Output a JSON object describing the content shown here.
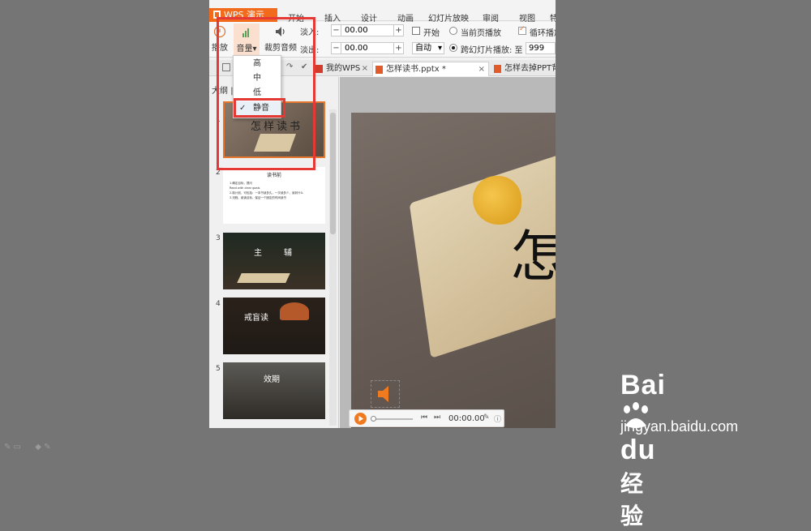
{
  "app": {
    "title": "WPS 演示"
  },
  "menu": [
    "开始",
    "插入",
    "设计",
    "动画",
    "幻灯片放映",
    "审阅",
    "视图",
    "特"
  ],
  "ribbon": {
    "play_label": "播放",
    "volume_label": "音量",
    "volume_caret": "▾",
    "trim_label": "裁剪音频",
    "fade_in_label": "淡入:",
    "fade_in_value": "00.00",
    "fade_out_label": "淡出:",
    "fade_out_value": "00.00",
    "minus": "−",
    "plus": "+",
    "start_label": "开始",
    "start_value": "自动",
    "current_page_label": "当前页播放",
    "cross_slide_label": "跨幻灯片播放: 至",
    "cross_slide_value": "999",
    "loop_label": "循环播放"
  },
  "volume_menu": {
    "items": [
      "高",
      "中",
      "低",
      "静音"
    ],
    "selected_mark": "✓"
  },
  "tabs": [
    {
      "label": "我的WPS",
      "close": "×"
    },
    {
      "label": "怎样读书.pptx *",
      "close": "×"
    },
    {
      "label": "怎样去掉PPT背景"
    }
  ],
  "side": {
    "label": "大纲",
    "sep": "|"
  },
  "thumbnails": [
    {
      "num": "1",
      "title": "怎样读书"
    },
    {
      "num": "2",
      "title": "读书前",
      "lines": [
        "1.确定目标，提问",
        "Read with clear goals",
        "2.制计划，可包括：一本书读多久，一次读多少，读到什么",
        "3.流程、阅读目标，保证一个固定的时间读书"
      ]
    },
    {
      "num": "3",
      "title_a": "主",
      "title_b": "辅"
    },
    {
      "num": "4",
      "title": "戒盲读"
    },
    {
      "num": "5",
      "title": "效期"
    }
  ],
  "slide": {
    "title_char": "怎"
  },
  "player": {
    "time": "00:00.00"
  },
  "watermark": {
    "brand": "Bai",
    "brand2": "du",
    "brand_cn": "经验",
    "url": "jingyan.baidu.com"
  },
  "colors": {
    "accent": "#f26b1d",
    "highlight": "#e53935"
  }
}
